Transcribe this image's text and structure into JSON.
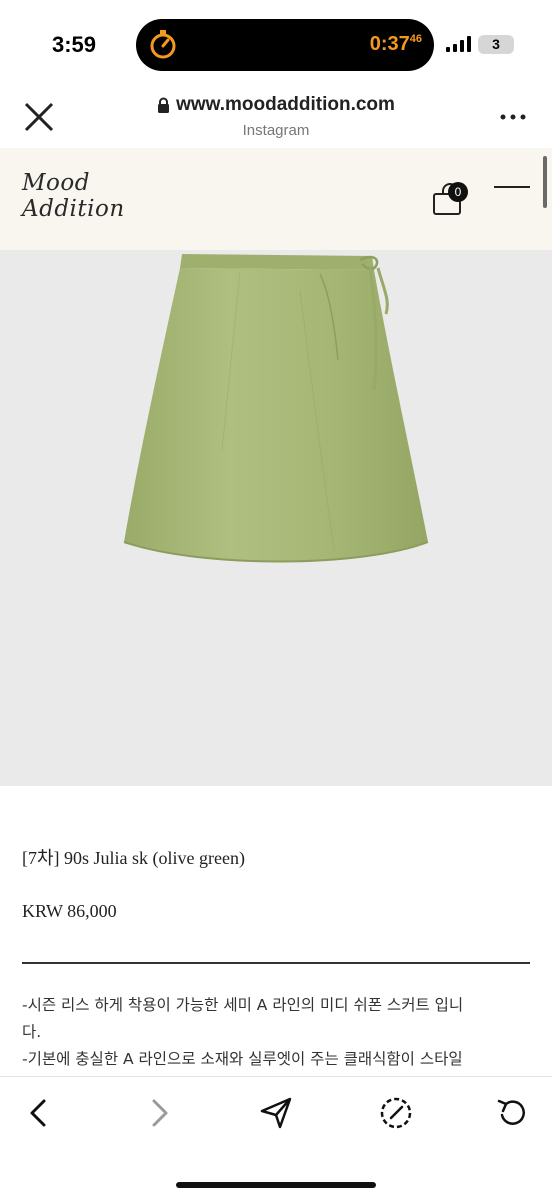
{
  "status_bar": {
    "time": "3:59",
    "timer_main": "0:37",
    "timer_sub": "46",
    "battery_level": "3",
    "accent_color": "#f39a1e"
  },
  "browser": {
    "url": "www.moodaddition.com",
    "source": "Instagram",
    "icons": [
      "close-icon",
      "lock-icon",
      "more-icon"
    ]
  },
  "site": {
    "logo_line1": "Mood",
    "logo_line2": "Addition",
    "cart_count": "0",
    "header_bg": "#f8f6ef"
  },
  "product": {
    "title": "[7차] 90s Julia sk (olive green)",
    "price": "KRW 86,000",
    "description": [
      "-시즌 리스 하게 착용이 가능한 세미 A 라인의 미디 쉬폰 스커트 입니",
      "다.",
      "-기본에 충실한 A 라인으로 소재와 실루엣이 주는 클래식함이 스타일"
    ],
    "image_bg": "#eaeaea",
    "skirt_color": "#a8b877"
  },
  "toolbar": {
    "icons": [
      "back-arrow-icon",
      "forward-arrow-icon",
      "share-icon",
      "compass-icon",
      "reload-icon"
    ]
  }
}
